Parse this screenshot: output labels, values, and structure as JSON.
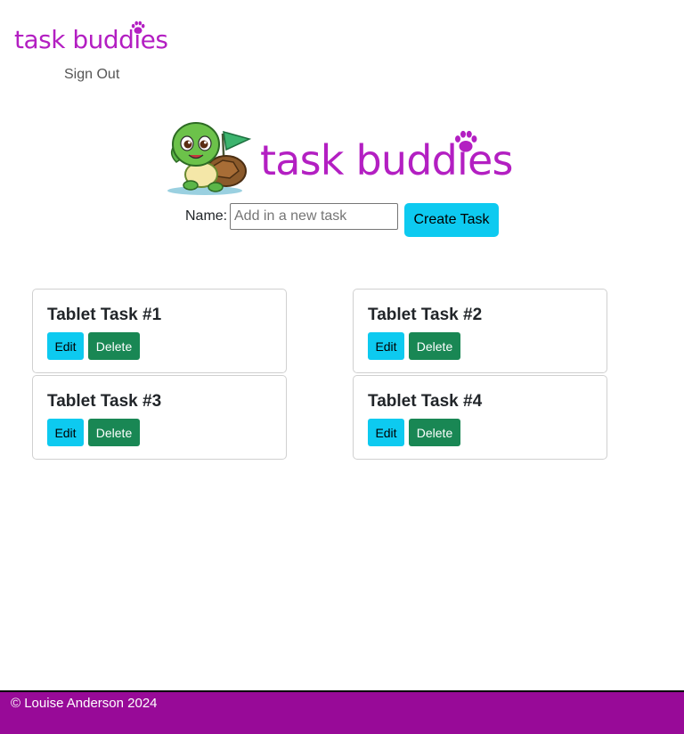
{
  "header": {
    "brand": "task buddies",
    "sign_out": "Sign Out"
  },
  "hero": {
    "title": "task buddies",
    "mascot_icon": "turtle-mascot-icon",
    "paw_icon": "paw-icon"
  },
  "form": {
    "label": "Name:",
    "placeholder": "Add in a new task",
    "value": "",
    "create_label": "Create Task"
  },
  "tasks": [
    {
      "title": "Tablet Task #1",
      "edit": "Edit",
      "delete": "Delete"
    },
    {
      "title": "Tablet Task #2",
      "edit": "Edit",
      "delete": "Delete"
    },
    {
      "title": "Tablet Task #3",
      "edit": "Edit",
      "delete": "Delete"
    },
    {
      "title": "Tablet Task #4",
      "edit": "Edit",
      "delete": "Delete"
    }
  ],
  "footer": {
    "text": "© Louise Anderson 2024"
  },
  "colors": {
    "brand": "#b31fc2",
    "primary_button": "#0dcaf0",
    "delete_button": "#198754",
    "footer": "#980a98"
  }
}
